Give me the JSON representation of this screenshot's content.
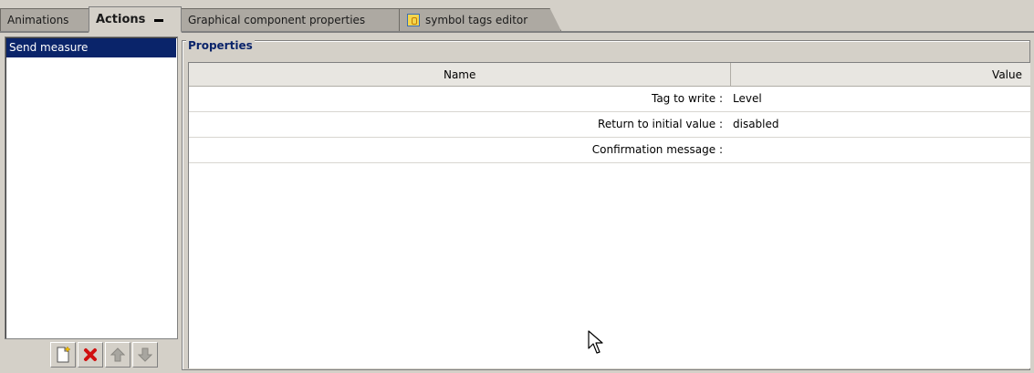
{
  "tabs": [
    {
      "label": "Animations",
      "active": false
    },
    {
      "label": "Actions",
      "active": true
    },
    {
      "label": "Graphical component properties",
      "active": false
    },
    {
      "label": "symbol tags editor",
      "active": false,
      "icon": "symbol-tags-icon"
    }
  ],
  "actions_list": {
    "items": [
      {
        "label": "Send measure",
        "selected": true
      }
    ],
    "buttons": [
      {
        "name": "new-action-button",
        "icon": "new-document-icon"
      },
      {
        "name": "delete-action-button",
        "icon": "delete-x-icon"
      },
      {
        "name": "move-up-button",
        "icon": "arrow-up-icon"
      },
      {
        "name": "move-down-button",
        "icon": "arrow-down-icon"
      }
    ]
  },
  "properties": {
    "legend": "Properties",
    "columns": {
      "name": "Name",
      "value": "Value"
    },
    "rows": [
      {
        "name": "Tag to write :",
        "value": "Level"
      },
      {
        "name": "Return to initial value :",
        "value": "disabled"
      },
      {
        "name": "Confirmation message :",
        "value": ""
      }
    ]
  },
  "colors": {
    "selection": "#0a246a",
    "legend_text": "#0a246a",
    "panel_bg": "#d4d0c8"
  }
}
